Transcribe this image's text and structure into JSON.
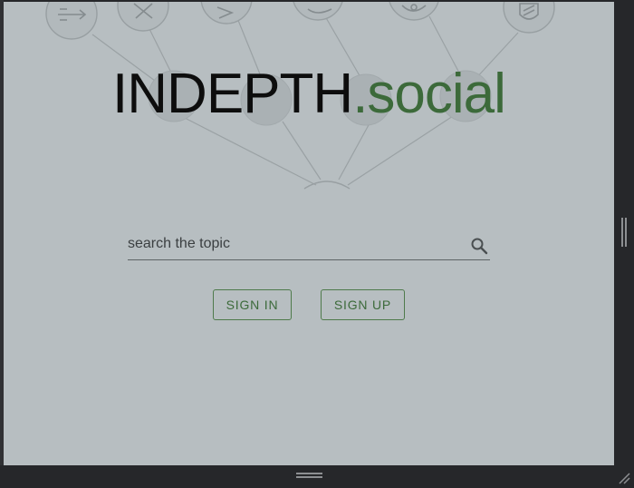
{
  "logo": {
    "main": "INDEPTH",
    "tld": ".social"
  },
  "search": {
    "placeholder": "search the topic",
    "value": "",
    "icon": "search-icon"
  },
  "auth": {
    "sign_in_label": "SIGN IN",
    "sign_up_label": "SIGN UP"
  },
  "colors": {
    "page_background": "#b7bec1",
    "brand_green": "#3c6a3a",
    "logo_text": "#0d0d0d",
    "chrome": "#26272a"
  },
  "background_illustration": {
    "type": "topic-tree-network",
    "node_icons": [
      "arrow-icon",
      "cross-icon",
      "play-icon",
      "chat-icon",
      "refresh-icon",
      "shield-icon",
      "blank-node",
      "blank-node",
      "blank-node",
      "root-node"
    ]
  }
}
